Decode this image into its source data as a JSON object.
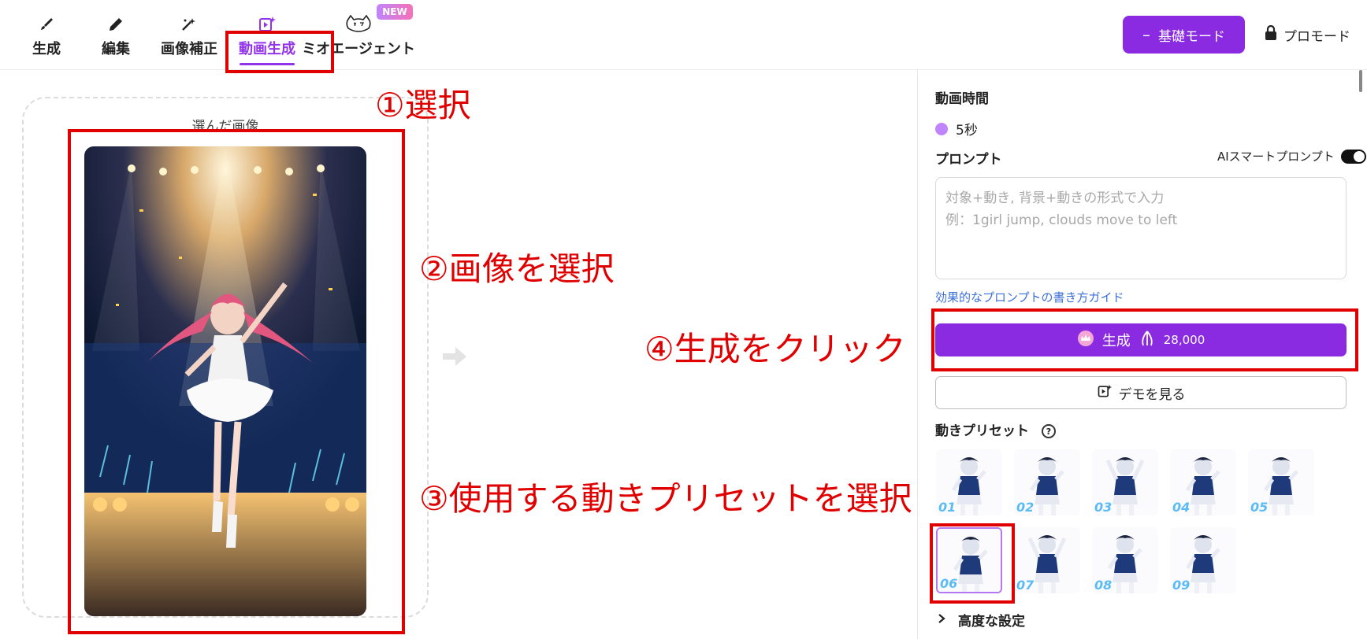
{
  "tabs": [
    {
      "label": "生成",
      "icon": "brush-icon"
    },
    {
      "label": "編集",
      "icon": "pencil-icon"
    },
    {
      "label": "画像補正",
      "icon": "magic-wand-icon"
    },
    {
      "label": "動画生成",
      "icon": "video-sparkle-icon"
    },
    {
      "label": "ミオエージェント",
      "icon": "cat-mascot-icon"
    }
  ],
  "active_tab": "動画生成",
  "new_badge": "NEW",
  "header": {
    "basic_mode": "基礎モード",
    "pro_mode": "プロモード"
  },
  "canvas": {
    "selected_image_label": "選んだ画像"
  },
  "panel": {
    "duration_label": "動画時間",
    "duration_value": "5秒",
    "prompt_label": "プロンプト",
    "ai_smart_prompt": "AIスマートプロンプト",
    "prompt_placeholder": "対象+動き, 背景+動きの形式で入力\n例：1girl jump, clouds move to left",
    "guide_link": "効果的なプロンプトの書き方ガイド",
    "generate_label": "生成",
    "generate_cost": "28,000",
    "demo_label": "デモを見る",
    "presets_label": "動きプリセット",
    "presets": [
      "01",
      "02",
      "03",
      "04",
      "05",
      "06",
      "07",
      "08",
      "09"
    ],
    "selected_preset": "06",
    "advanced_label": "高度な設定"
  },
  "annotations": {
    "step1": "①選択",
    "step2": "②画像を選択",
    "step3": "③使用する動きプリセットを選択",
    "step4": "④生成をクリック"
  },
  "colors": {
    "accent": "#8a2be2",
    "annotation": "#e00000",
    "link": "#3b6fd8"
  }
}
